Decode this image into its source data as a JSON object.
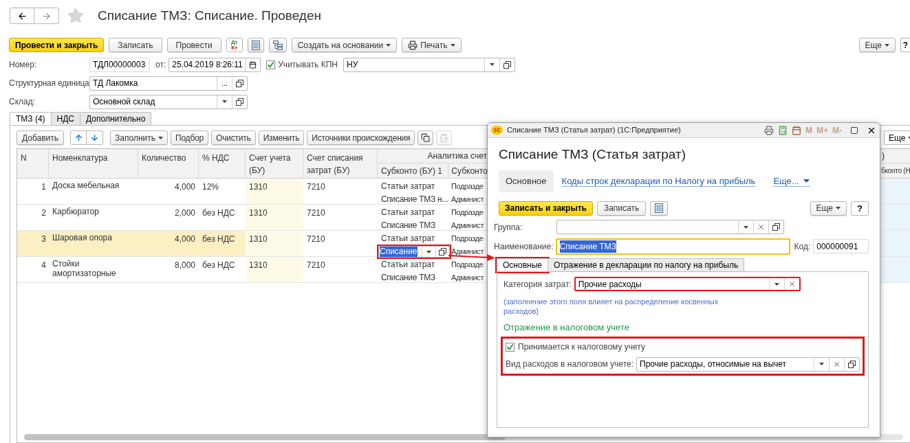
{
  "window": {
    "title": "Списание ТМЗ: Списание. Проведен",
    "favorite": false
  },
  "toolbar": {
    "primary": "Провести и закрыть",
    "buttons": [
      "Записать",
      "Провести"
    ],
    "dt_kt": [
      "Дт",
      "Кт"
    ],
    "create_based_on": "Создать на основании",
    "print": "Печать",
    "more": "Еще",
    "help": "?"
  },
  "header_fields": {
    "number_label": "Номер:",
    "number": "ТДЛ00000003",
    "date_label": "от:",
    "date": "25.04.2019  8:26:11",
    "kpn_checkbox": {
      "label": "Учитывать КПН",
      "checked": true
    },
    "kpn_value": "НУ",
    "unit_label": "Структурная единица:",
    "unit": "ТД Лакомка",
    "unit_select": "...",
    "warehouse_label": "Склад:",
    "warehouse": "Основной склад"
  },
  "tabs": [
    {
      "label": "ТМЗ (4)",
      "selected": true
    },
    {
      "label": "НДС",
      "selected": false
    },
    {
      "label": "Дополнительно",
      "selected": false
    }
  ],
  "table_toolbar": {
    "add": "Добавить",
    "fill": "Заполнить",
    "buttons": [
      "Подбор",
      "Очистить",
      "Изменить",
      "Источники происхождения"
    ],
    "paste_disabled": true,
    "more": "Еще"
  },
  "table": {
    "columns": [
      "N",
      "Номенклатура",
      "Количество",
      "% НДС",
      "Счет учета (БУ)",
      "Счет списания затрат (БУ)"
    ],
    "group_header": "Аналитика счет",
    "sub_columns": [
      "Субконто (БУ) 1",
      "Субконто"
    ],
    "right_header_top": ")",
    "right_header": "бконто (Н",
    "rows": [
      {
        "n": "1",
        "name": "Доска мебельная",
        "qty": "4,000",
        "vat": "12%",
        "account": "1310",
        "expense_account": "7210",
        "subkonto_1": {
          "line_1": "Статьи затрат",
          "line_2": "Списание ТМЗ н...",
          "editing": false,
          "highlighted": false
        },
        "subkonto_2": [
          "Подразде",
          "Админист"
        ],
        "selected": false
      },
      {
        "n": "2",
        "name": "Карбюратор",
        "qty": "2,000",
        "vat": "без НДС",
        "account": "1310",
        "expense_account": "7210",
        "subkonto_1": {
          "line_1": "Статьи затрат",
          "line_2": "Списание ТМЗ",
          "editing": false,
          "highlighted": false
        },
        "subkonto_2": [
          "Подразде",
          "Админист"
        ],
        "selected": false
      },
      {
        "n": "3",
        "name": "Шаровая опора",
        "qty": "4,000",
        "vat": "без НДС",
        "account": "1310",
        "expense_account": "7210",
        "subkonto_1": {
          "line_1": "Статьи затрат",
          "line_2": "Списание",
          "editing": true,
          "highlighted": true
        },
        "subkonto_2": [
          "Подразде",
          "Админист"
        ],
        "selected": true
      },
      {
        "n": "4",
        "name": "Стойки амортизаторные",
        "qty": "8,000",
        "vat": "без НДС",
        "account": "1310",
        "expense_account": "7210",
        "subkonto_1": {
          "line_1": "Статьи затрат",
          "line_2": "Списание ТМЗ",
          "editing": false,
          "highlighted": false
        },
        "subkonto_2": [
          "Подразде",
          "Админист"
        ],
        "selected": false
      }
    ]
  },
  "dialog": {
    "logo": "1С",
    "title": "Списание ТМЗ (Статья затрат)  (1С:Предприятие)",
    "memory_buttons": [
      "M",
      "M+",
      "M-"
    ],
    "heading": "Списание ТМЗ (Статья затрат)",
    "nav": [
      {
        "label": "Основное",
        "selected": true
      },
      {
        "label": "Коды строк декларации по Налогу на прибыль",
        "selected": false
      }
    ],
    "nav_more": "Еще...",
    "primary": "Записать и закрыть",
    "save": "Записать",
    "more": "Еще",
    "help": "?",
    "group_label": "Группа:",
    "name_label": "Наименование:",
    "name": "Списание ТМЗ",
    "code_label": "Код:",
    "code": "000000091",
    "tabs": [
      {
        "label": "Основные",
        "selected": true,
        "highlighted": true
      },
      {
        "label": "Отражение в декларации по налогу на прибыль",
        "selected": false,
        "highlighted": false
      }
    ],
    "category_label": "Категория затрат:",
    "category": "Прочие расходы",
    "category_highlighted": true,
    "note": "(заполнение этого поля влияет на распределение косвенных расходов)",
    "tax_heading": "Отражение в налоговом учете",
    "tax_highlighted": true,
    "tax_checkbox": {
      "label": "Принимается к налоговому учету",
      "checked": true
    },
    "tax_kind_label": "Вид расходов в налоговом учете:",
    "tax_kind": "Прочие расходы, относимые на вычет"
  }
}
